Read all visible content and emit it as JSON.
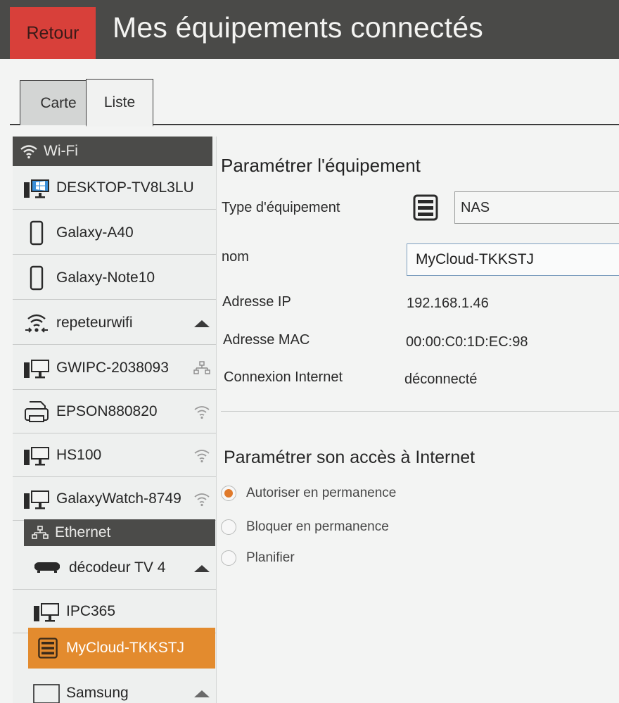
{
  "header": {
    "back_label": "Retour",
    "title": "Mes équipements connectés"
  },
  "tabs": [
    {
      "label": "Carte"
    },
    {
      "label": "Liste",
      "active": true
    }
  ],
  "sidebar": {
    "wifi_section": "Wi-Fi",
    "ethernet_section": "Ethernet",
    "wifi_devices": [
      {
        "label": "DESKTOP-TV8L3LU",
        "icon": "desktop-windows-icon"
      },
      {
        "label": "Galaxy-A40",
        "icon": "phone-icon"
      },
      {
        "label": "Galaxy-Note10",
        "icon": "phone-icon"
      },
      {
        "label": "repeteurwifi",
        "icon": "wifi-repeater-icon",
        "side_icon": "collapse-up-icon"
      },
      {
        "label": "GWIPC-2038093",
        "icon": "desktop-icon",
        "side_icon": "ethernet-icon"
      },
      {
        "label": "EPSON880820",
        "icon": "printer-icon",
        "side_icon": "wifi-icon"
      },
      {
        "label": "HS100",
        "icon": "desktop-icon",
        "side_icon": "wifi-icon"
      },
      {
        "label": "GalaxyWatch-8749",
        "icon": "desktop-icon",
        "side_icon": "wifi-icon"
      }
    ],
    "ethernet_devices": [
      {
        "label": "décodeur TV 4",
        "icon": "decoder-icon",
        "side_icon": "collapse-up-icon"
      },
      {
        "label": "IPC365",
        "icon": "desktop-icon"
      },
      {
        "label": "MyCloud-TKKSTJ",
        "icon": "nas-icon",
        "selected": true
      },
      {
        "label": "Samsung",
        "icon": "tv-icon",
        "side_icon": "collapse-up-icon"
      }
    ]
  },
  "details": {
    "heading": "Paramétrer l'équipement",
    "type_label": "Type d'équipement",
    "type_value": "NAS",
    "name_label": "nom",
    "name_value": "MyCloud-TKKSTJ",
    "ip_label": "Adresse IP",
    "ip_value": "192.168.1.46",
    "mac_label": "Adresse MAC",
    "mac_value": "00:00:C0:1D:EC:98",
    "internet_label": "Connexion Internet",
    "internet_value": "déconnecté"
  },
  "access": {
    "heading": "Paramétrer son accès à Internet",
    "options": [
      {
        "label": "Autoriser en permanence",
        "checked": true
      },
      {
        "label": "Bloquer en permanence",
        "checked": false
      },
      {
        "label": "Planifier",
        "checked": false
      }
    ]
  },
  "colors": {
    "header_bg": "#4a4a48",
    "back_button": "#d8403a",
    "accent": "#e38b2e",
    "radio_checked": "#e07a2b"
  }
}
